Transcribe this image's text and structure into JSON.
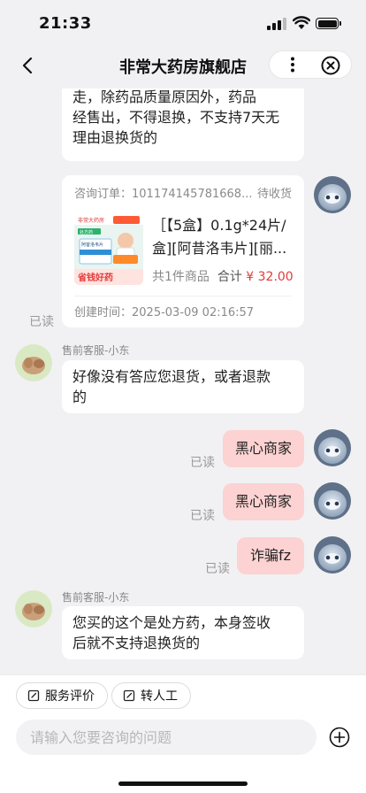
{
  "status_bar": {
    "time": "21:33"
  },
  "nav": {
    "title": "非常大药房旗舰店"
  },
  "messages": {
    "partial_top": [
      "走，除药品质量原因外，药品",
      "经售出，不得退换，不支持7天无",
      "理由退换货的"
    ],
    "order_card": {
      "order_label": "咨询订单：",
      "order_no": "101174145781668...",
      "status": "待收货",
      "product_line1": "［【5盒】0.1g*24片/",
      "product_line2": "盒][阿昔洛韦片][丽...",
      "count": "共1件商品",
      "total_label": "合计",
      "total_value": "¥ 32.00",
      "created": "创建时间：2025-03-09 02:16:57",
      "read": "已读",
      "thumb_texts": {
        "brand": "非常大药房",
        "badge": "处方药",
        "name": "阿昔洛韦片",
        "banner": "省钱好药"
      }
    },
    "agent_1": {
      "sender": "售前客服-小东",
      "line1": "好像没有答应您退货，或者退款",
      "line2": "的"
    },
    "user_1": {
      "text": "黑心商家",
      "read": "已读"
    },
    "user_2": {
      "text": "黑心商家",
      "read": "已读"
    },
    "user_3": {
      "text": "诈骗fz",
      "read": "已读"
    },
    "agent_2": {
      "sender": "售前客服-小东",
      "line1": "您买的这个是处方药，本身签收",
      "line2": "后就不支持退换货的"
    }
  },
  "bottom": {
    "chip_rate": "服务评价",
    "chip_human": "转人工",
    "input_placeholder": "请输入您要咨询的问题"
  },
  "colors": {
    "user_bubble": "#fcd2d2",
    "price": "#e23b3b",
    "background": "#f1f1f3"
  }
}
